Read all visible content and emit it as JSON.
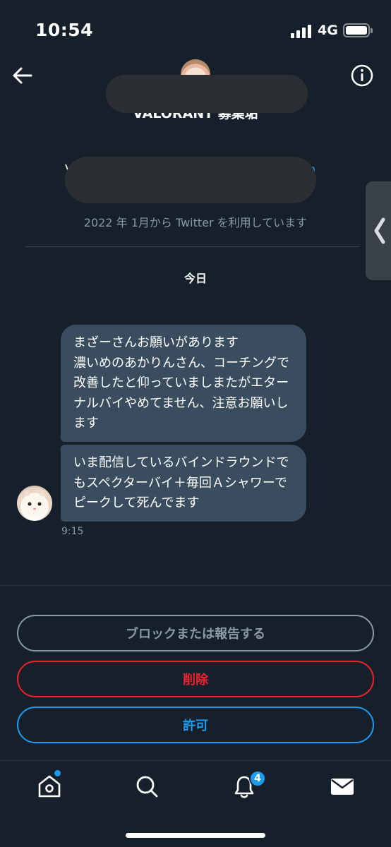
{
  "status_bar": {
    "time": "10:54",
    "network": "4G"
  },
  "header": {
    "title": "VALORANT 募集垢"
  },
  "profile": {
    "bio_left": "V",
    "bio_right": "n",
    "joined": "2022 年 1月から Twitter を利用しています"
  },
  "conversation": {
    "date_label": "今日",
    "messages": [
      {
        "text": "まざーさんお願いがあります\n濃いめのあかりんさん、コーチングで改善したと仰っていましまたがエターナルバイやめてません、注意お願いします"
      },
      {
        "text": "いま配信しているバインドラウンドでもスペクターバイ＋毎回Ａシャワーでピークして死んでます"
      }
    ],
    "timestamp": "9:15"
  },
  "actions": {
    "block_label": "ブロックまたは報告する",
    "delete_label": "削除",
    "allow_label": "許可"
  },
  "tab_bar": {
    "notification_count": "4"
  },
  "icons": {
    "back": "arrow-left-icon",
    "info": "info-icon",
    "home": "home-icon",
    "search": "search-icon",
    "notifications": "bell-icon",
    "messages": "envelope-icon",
    "handle": "chevron-left-icon"
  },
  "colors": {
    "background": "#15202b",
    "bubble": "#3a4d5e",
    "accent": "#1d9bf0",
    "danger": "#f4212e",
    "muted": "#8b98a5"
  }
}
